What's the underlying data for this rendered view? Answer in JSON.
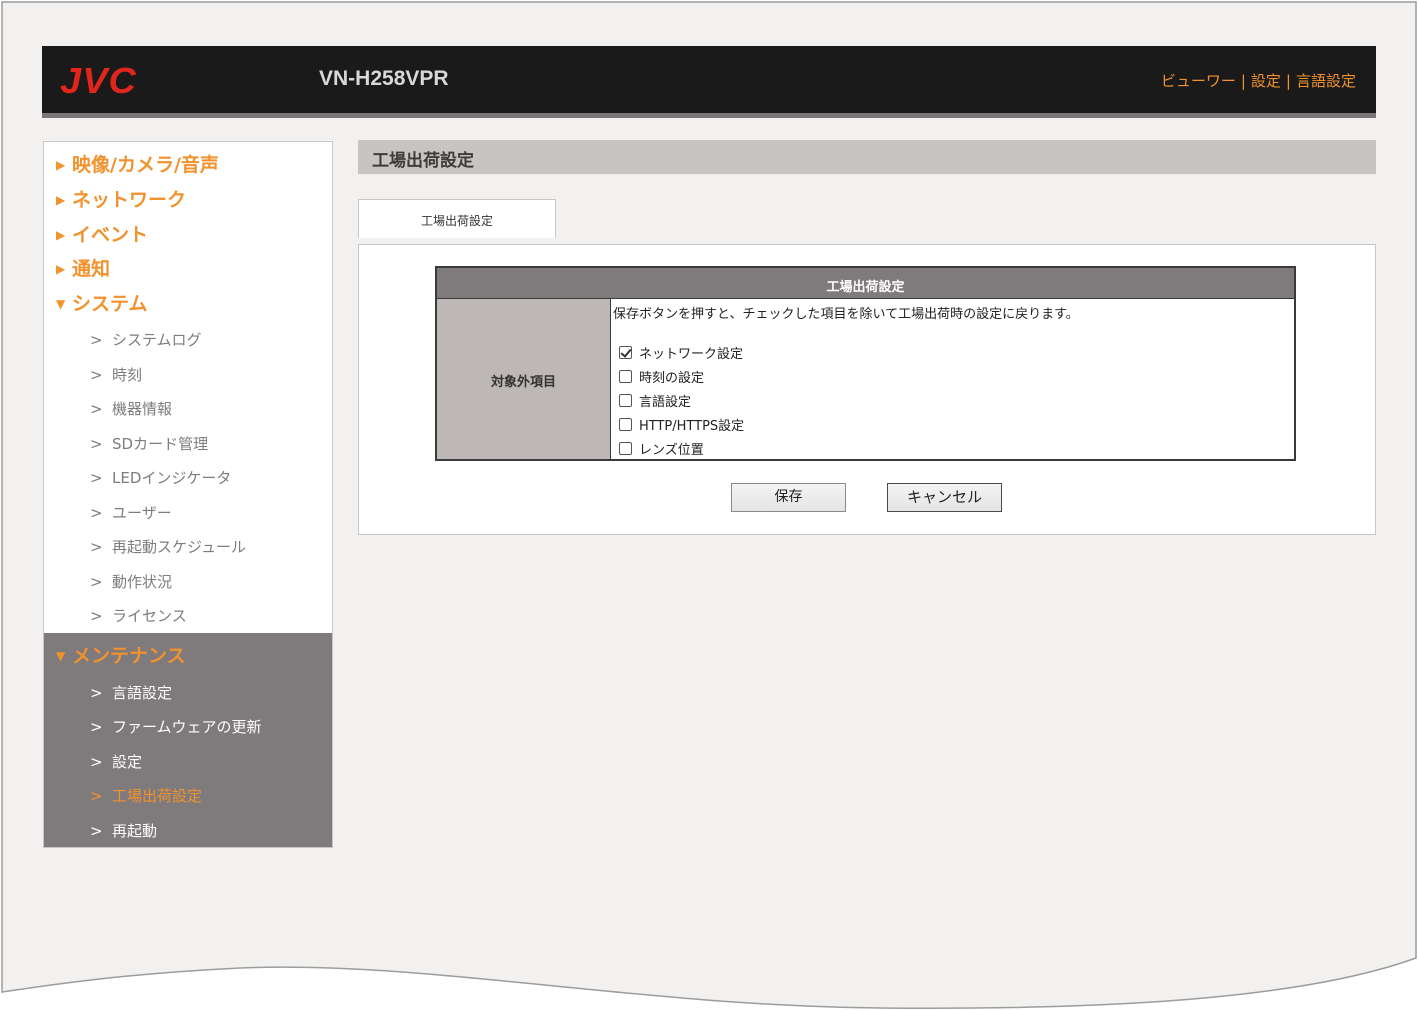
{
  "header": {
    "logo": "JVC",
    "model": "VN-H258VPR",
    "links": [
      "ビューワー",
      "設定",
      "言語設定"
    ],
    "link_separator": "|"
  },
  "sidebar": {
    "categories": [
      {
        "label": "映像/カメラ/音声",
        "state": "collapsed"
      },
      {
        "label": "ネットワーク",
        "state": "collapsed"
      },
      {
        "label": "イベント",
        "state": "collapsed"
      },
      {
        "label": "通知",
        "state": "collapsed"
      },
      {
        "label": "システム",
        "state": "expanded"
      }
    ],
    "system_items": [
      "システムログ",
      "時刻",
      "機器情報",
      "SDカード管理",
      "LEDインジケータ",
      "ユーザー",
      "再起動スケジュール",
      "動作状況",
      "ライセンス"
    ],
    "maintenance": {
      "label": "メンテナンス",
      "state": "expanded",
      "items": [
        "言語設定",
        "ファームウェアの更新",
        "設定",
        "工場出荷設定",
        "再起動"
      ],
      "active_index": 3
    },
    "collapsed_arrow": "▶",
    "expanded_arrow": "▼",
    "sub_chevron": ">"
  },
  "main": {
    "section_title": "工場出荷設定",
    "tab_label": "工場出荷設定",
    "table": {
      "header": "工場出荷設定",
      "row_label": "対象外項目",
      "description": "保存ボタンを押すと、チェックした項目を除いて工場出荷時の設定に戻ります。",
      "options": [
        {
          "label": "ネットワーク設定",
          "checked": true
        },
        {
          "label": "時刻の設定",
          "checked": false
        },
        {
          "label": "言語設定",
          "checked": false
        },
        {
          "label": "HTTP/HTTPS設定",
          "checked": false
        },
        {
          "label": "レンズ位置",
          "checked": false
        }
      ]
    },
    "buttons": {
      "save": "保存",
      "cancel": "キャンセル"
    }
  },
  "colors": {
    "accent": "#f2922c",
    "logo_red": "#e0251b",
    "header_bg": "#1a1a1a",
    "maintenance_bg": "#7f7a7b",
    "section_title_bg": "#c8c4c1",
    "page_bg": "#f2f1ef"
  }
}
